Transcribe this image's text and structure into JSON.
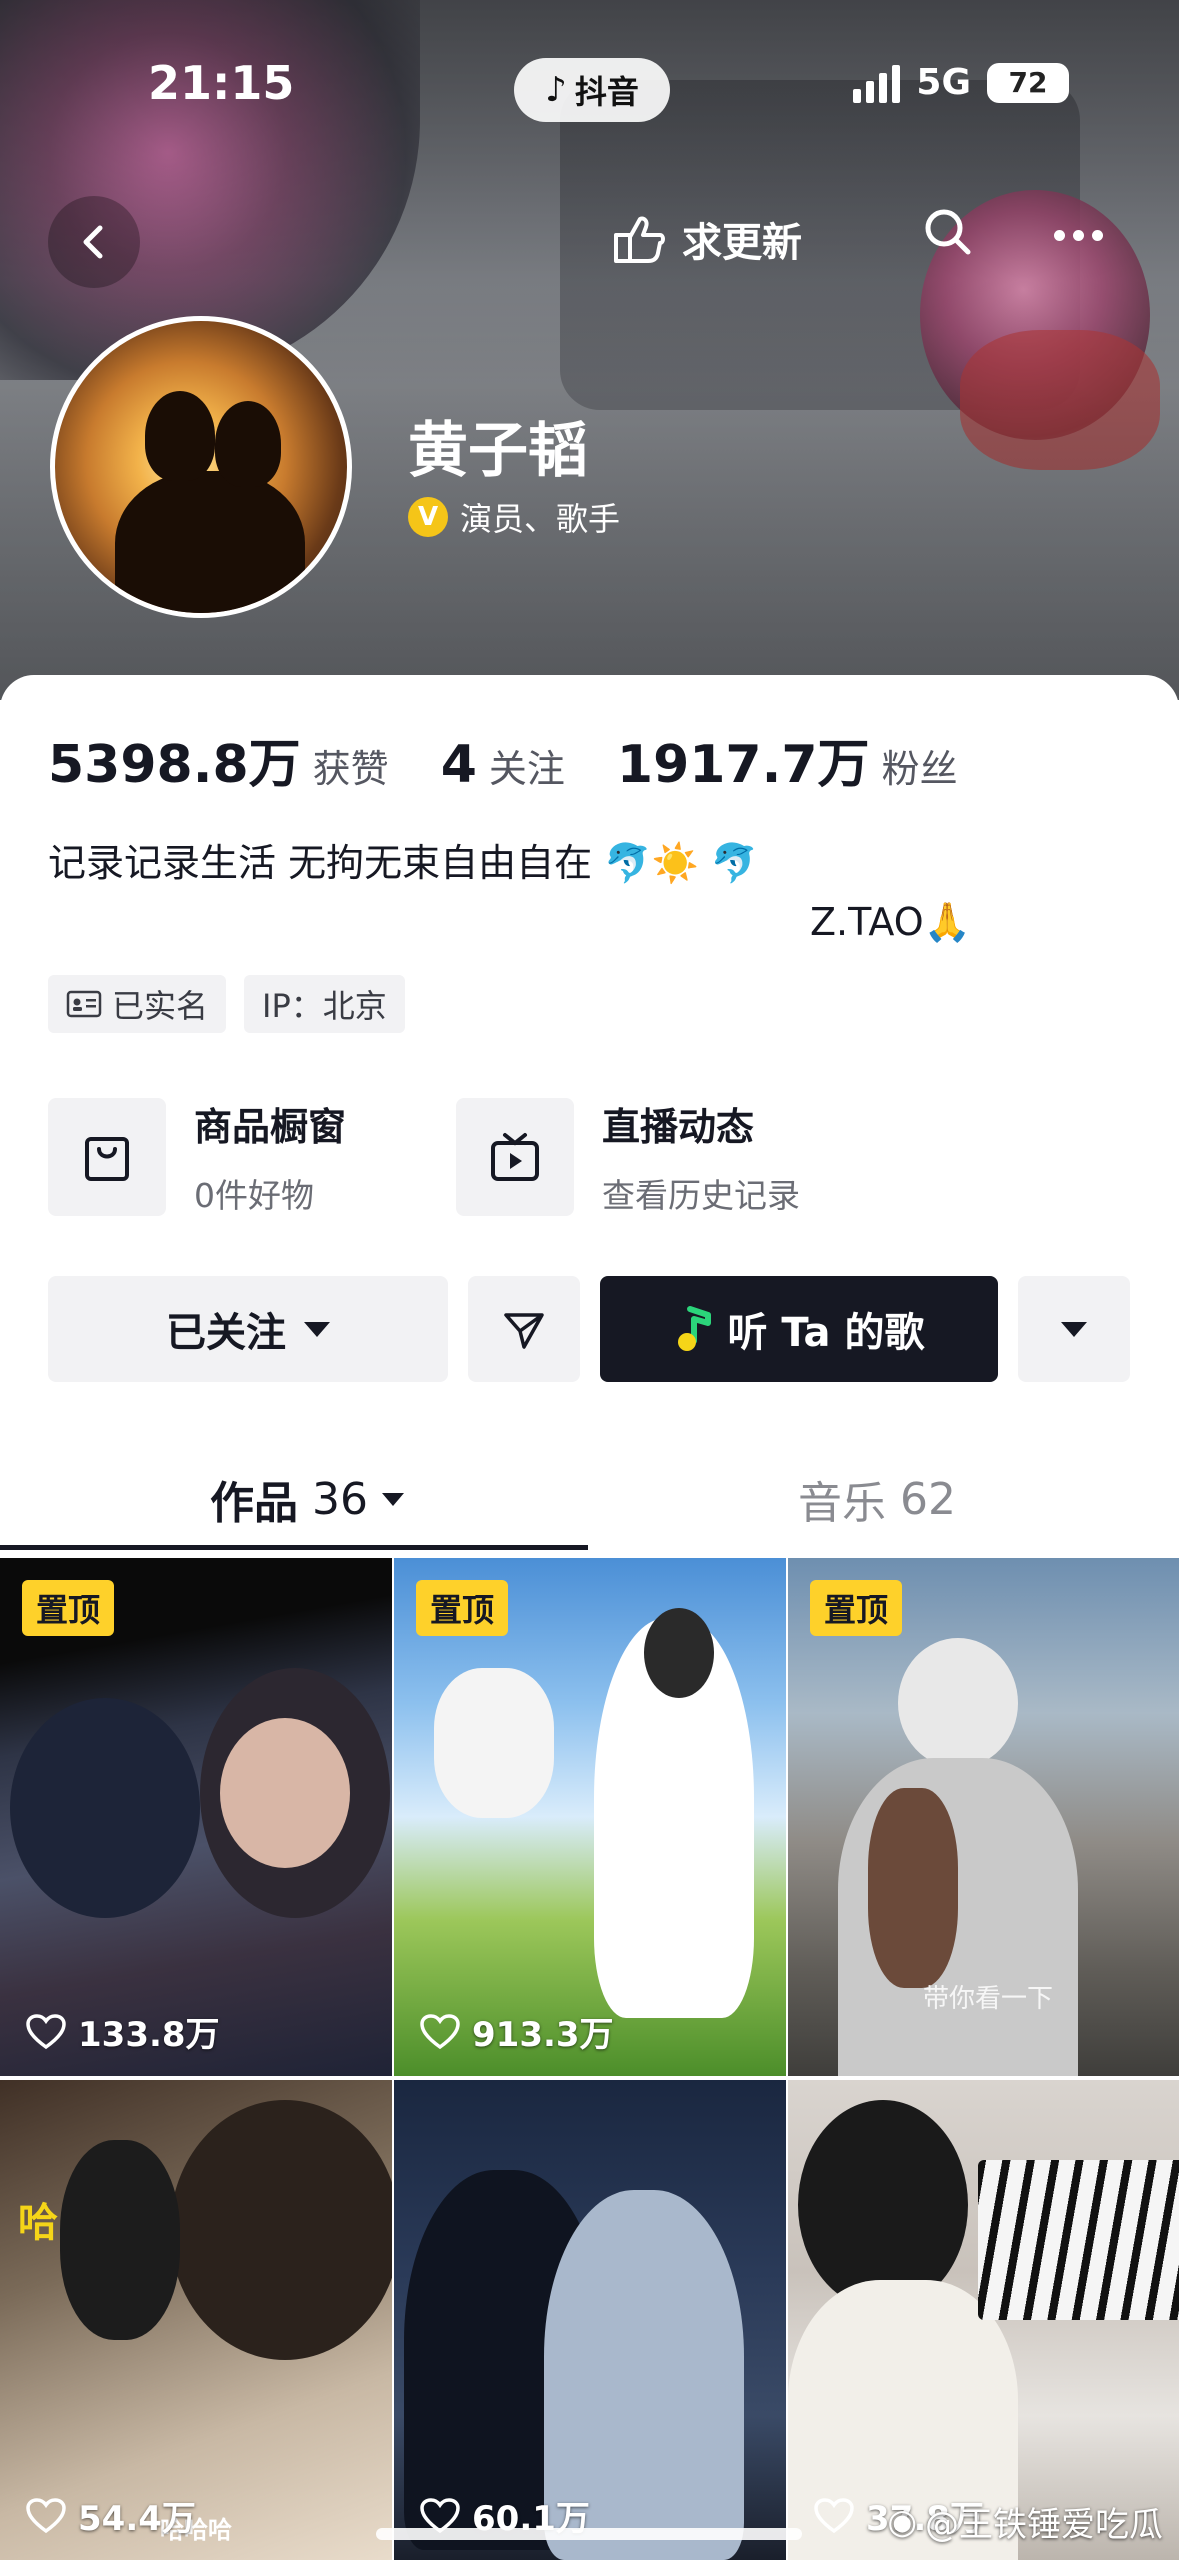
{
  "status_bar": {
    "time": "21:15",
    "network": "5G",
    "battery": "72"
  },
  "app_pill": {
    "label": "抖音"
  },
  "top_bar": {
    "update_label": "求更新"
  },
  "profile": {
    "name": "黄子韬",
    "verification": "演员、歌手"
  },
  "stats": {
    "likes_value": "5398.8万",
    "likes_label": "获赞",
    "following_value": "4",
    "following_label": "关注",
    "followers_value": "1917.7万",
    "followers_label": "粉丝"
  },
  "bio": {
    "line1": "记录记录生活 无拘无束自由自在 🐬☀️ 🐬",
    "line2": "Z.TAO🙏"
  },
  "tags": {
    "verified": "已实名",
    "ip": "IP：北京"
  },
  "features": {
    "shop_title": "商品橱窗",
    "shop_sub": "0件好物",
    "live_title": "直播动态",
    "live_sub": "查看历史记录"
  },
  "actions": {
    "followed": "已关注",
    "listen_song": "听 Ta 的歌"
  },
  "tabs": {
    "works_label": "作品",
    "works_count": "36",
    "music_label": "音乐",
    "music_count": "62"
  },
  "videos": [
    {
      "pinned": "置顶",
      "likes": "133.8万"
    },
    {
      "pinned": "置顶",
      "likes": "913.3万"
    },
    {
      "pinned": "置顶",
      "caption": "带你看一下"
    },
    {
      "caption": "哈哈哈",
      "caption2": "哈",
      "likes": "54.4万"
    },
    {
      "likes": "60.1万"
    },
    {
      "likes": "37.8万"
    }
  ],
  "watermark": "@王铁锤爱吃瓜",
  "colors": {
    "pin": "#fed12a",
    "primary_dark": "#161823",
    "verify": "#f5c518"
  }
}
